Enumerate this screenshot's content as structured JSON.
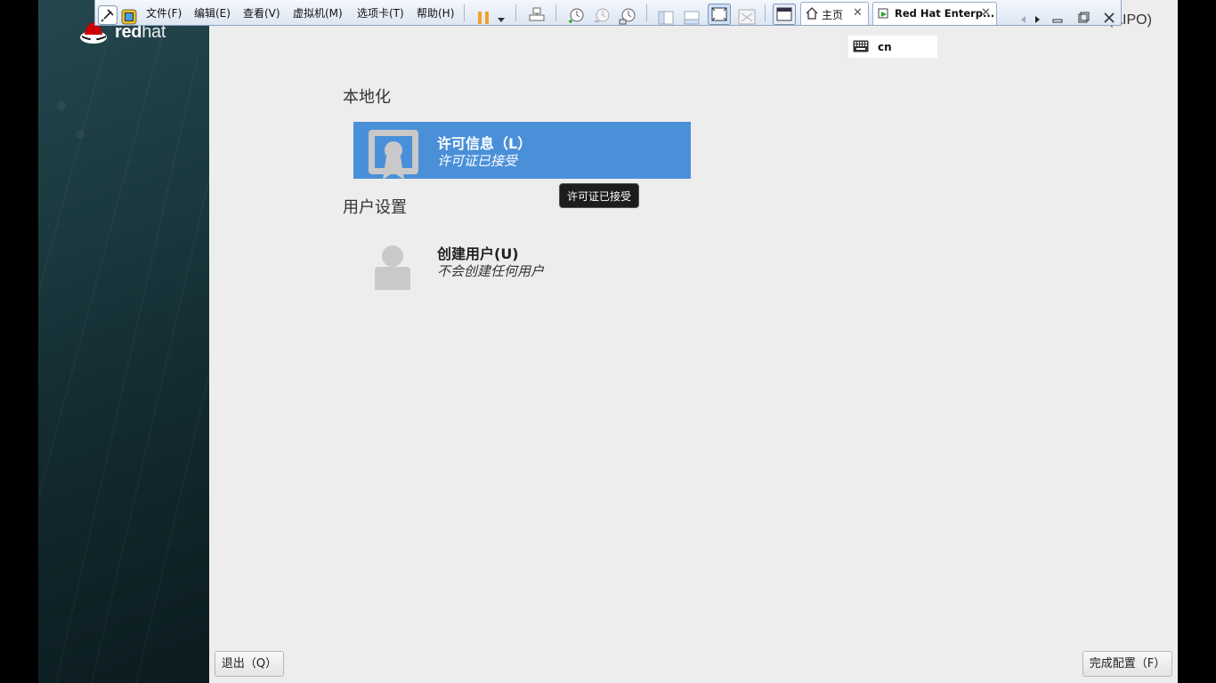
{
  "vm_toolbar": {
    "menus": [
      {
        "label": "文件(F)"
      },
      {
        "label": "编辑(E)"
      },
      {
        "label": "查看(V)"
      },
      {
        "label": "虚拟机(M)"
      },
      {
        "label": "选项卡(T)"
      },
      {
        "label": "帮助(H)"
      }
    ],
    "tabs": [
      {
        "label": "主页",
        "close": "✕"
      },
      {
        "label": "Red Hat Enterp...",
        "close": "✕"
      }
    ],
    "accent_color": "#f0a030"
  },
  "brand": {
    "bold": "red",
    "light": "hat"
  },
  "top_right": {
    "hostname": "(AIPO)",
    "keyboard_layout": "cn"
  },
  "sections": [
    {
      "title": "本地化",
      "spokes": [
        {
          "title": "许可信息（L）",
          "status": "许可证已接受",
          "selected": true,
          "icon": "license-icon"
        }
      ]
    },
    {
      "title": "用户设置",
      "spokes": [
        {
          "title": "创建用户(U)",
          "status": "不会创建任何用户",
          "selected": false,
          "icon": "user-icon"
        }
      ]
    }
  ],
  "tooltip": "许可证已接受",
  "buttons": {
    "quit": "退出（Q）",
    "finish": "完成配置（F）"
  },
  "colors": {
    "selected_spoke": "#4a90d9",
    "content_bg": "#ededed",
    "sidebar_bg": "#1b3a40"
  }
}
